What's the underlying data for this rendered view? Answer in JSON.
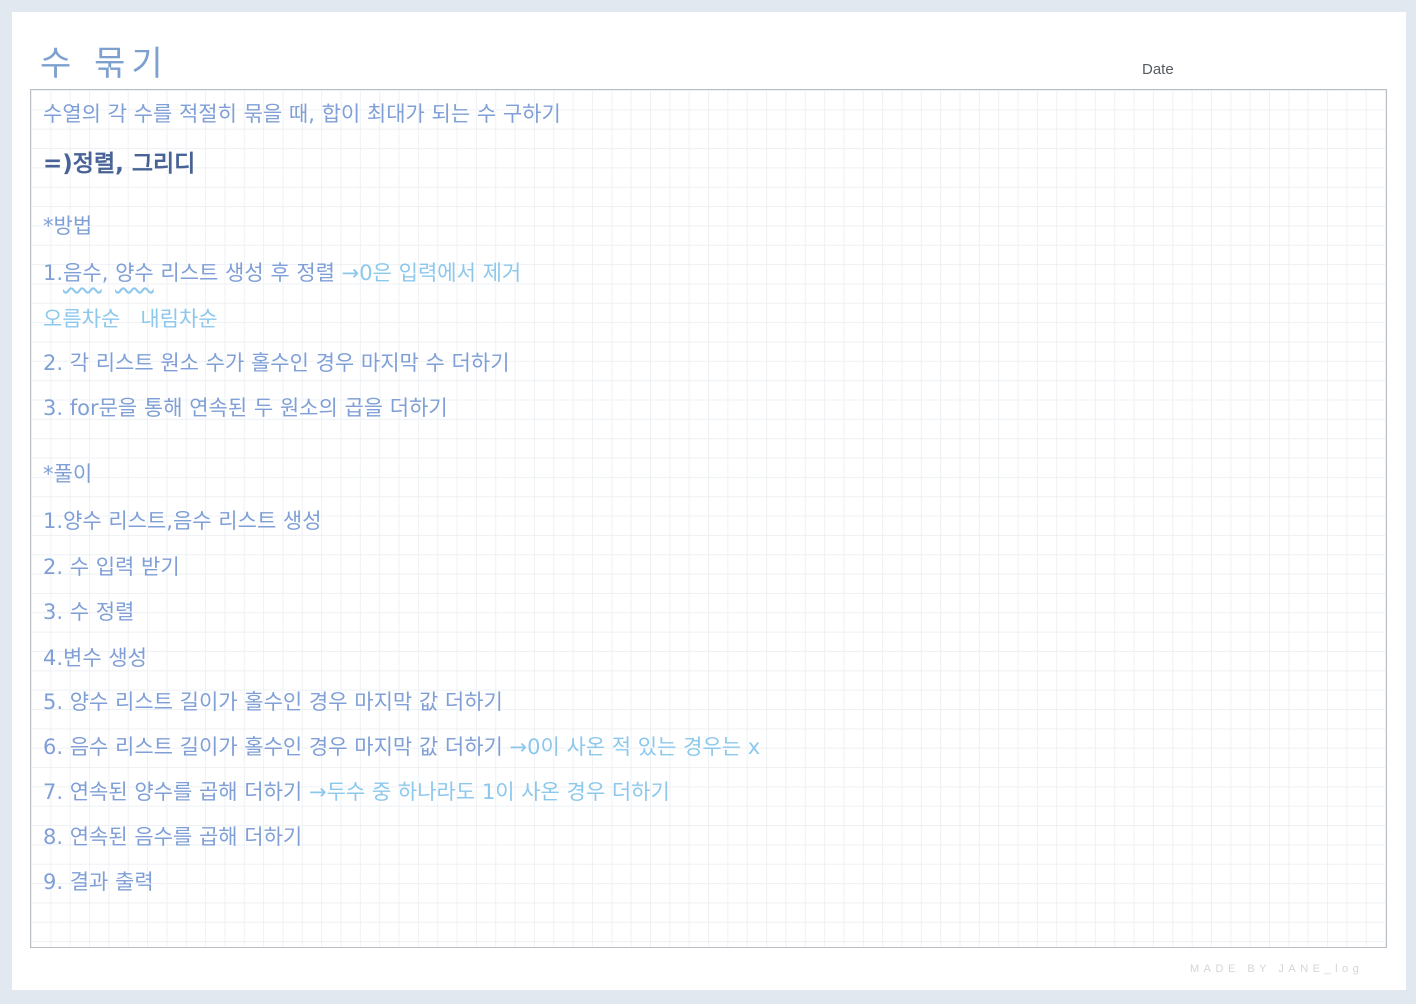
{
  "header": {
    "title": "수 묶기",
    "date_label": "Date"
  },
  "content": {
    "intro": "수열의 각 수를 적절히 묶을 때, 합이 최대가 되는 수 구하기",
    "category": "=)정렬, 그리디",
    "method": {
      "heading": "*방법",
      "step1_prefix": "1.",
      "step1_neg": "음수",
      "step1_sep": ",",
      "step1_pos": "양수",
      "step1_rest": "리스트 생성 후 정렬",
      "step1_arrow": "→",
      "step1_note": "0은 입력에서 제거",
      "sort_note_neg": "오름차순",
      "sort_note_pos": "내림차순",
      "step2": "2. 각 리스트 원소 수가 홀수인 경우 마지막 수 더하기",
      "step3": "3. for문을 통해 연속된 두 원소의 곱을 더하기"
    },
    "solution": {
      "heading": "*풀이",
      "s1": "1.양수 리스트,음수 리스트 생성",
      "s2": "2. 수 입력 받기",
      "s3": "3. 수 정렬",
      "s4": "4.변수 생성",
      "s5": "5. 양수 리스트 길이가 홀수인 경우 마지막 값 더하기",
      "s6": "6. 음수 리스트 길이가 홀수인 경우 마지막 값 더하기",
      "s6_arrow": "→",
      "s6_note": "0이 사온 적 있는 경우는 x",
      "s7": "7. 연속된 양수를 곱해 더하기",
      "s7_arrow": "→",
      "s7_note": "두수 중 하나라도 1이 사온 경우 더하기",
      "s8": "8. 연속된 음수를 곱해 더하기",
      "s9": "9. 결과 출력"
    }
  },
  "footer": {
    "credit": "MADE BY JANE_log"
  },
  "colors": {
    "ink_blue": "#7f9fd6",
    "ink_dark": "#4a6397",
    "ink_light": "#8cc8ec",
    "background": "#e1e8ef"
  }
}
